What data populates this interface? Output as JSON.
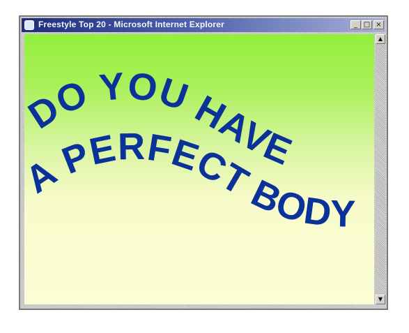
{
  "window": {
    "title": "Freestyle Top 20 - Microsoft Internet Explorer",
    "controls": {
      "minimize_icon": "minimize-icon",
      "maximize_icon": "maximize-icon",
      "close_icon": "close-icon"
    }
  },
  "content": {
    "headline_lines": [
      "DO YOU HAVE",
      "A PERFECT BODY?"
    ]
  },
  "colors": {
    "headline": "#0a3299",
    "background_top": "#94ef3c",
    "background_bottom": "#fbfdd5"
  }
}
